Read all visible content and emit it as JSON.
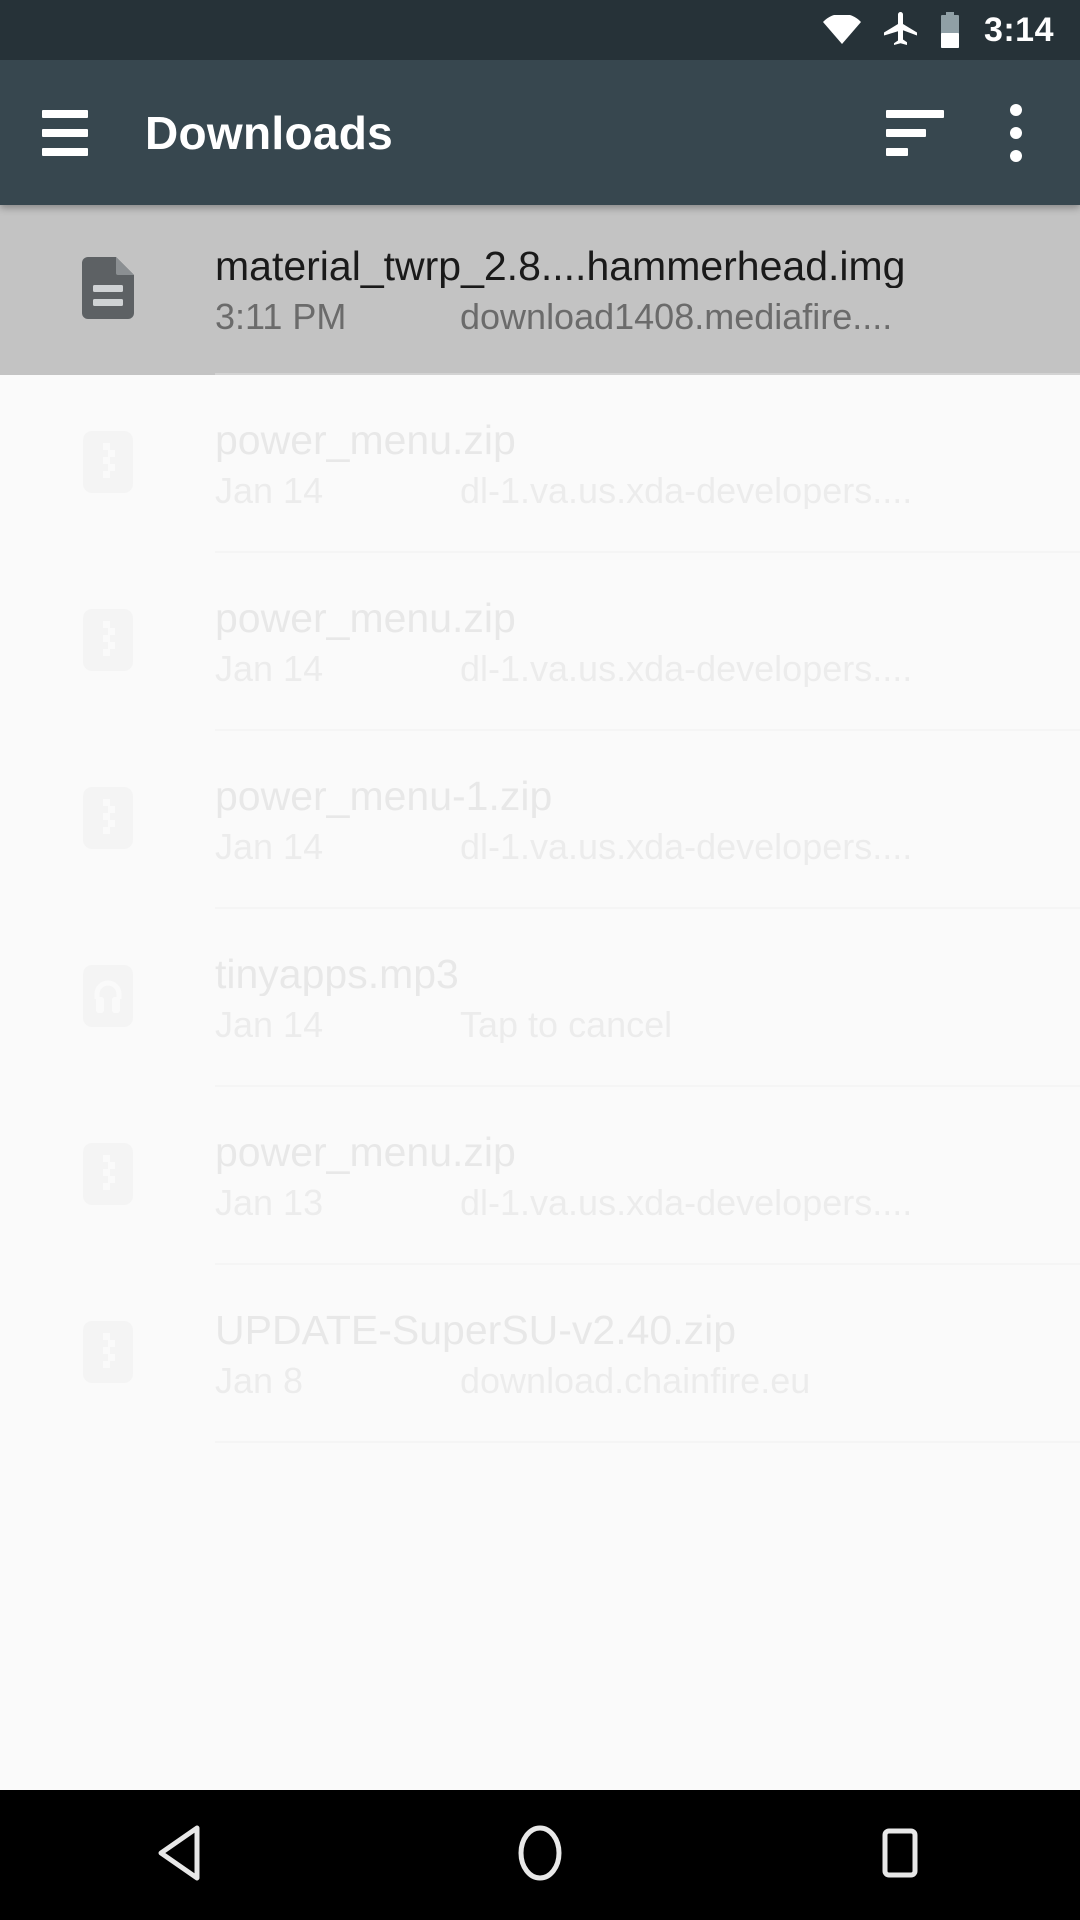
{
  "statusbar": {
    "time": "3:14",
    "icons": [
      "wifi-icon",
      "airplane-mode-icon",
      "battery-icon"
    ],
    "battery_level_pct": 42,
    "background": "#263238"
  },
  "toolbar": {
    "title": "Downloads",
    "menu_icon": "hamburger-menu-icon",
    "sort_icon": "sort-icon",
    "overflow_icon": "overflow-menu-icon",
    "background": "#37474F"
  },
  "list": {
    "items": [
      {
        "name": "material_twrp_2.8....hammerhead.img",
        "date": "3:11 PM",
        "source": "download1408.mediafire....",
        "icon": "document-file-icon",
        "selected": true
      },
      {
        "name": "power_menu.zip",
        "date": "Jan 14",
        "source": "dl-1.va.us.xda-developers....",
        "icon": "zip-file-icon",
        "selected": false
      },
      {
        "name": "power_menu.zip",
        "date": "Jan 14",
        "source": "dl-1.va.us.xda-developers....",
        "icon": "zip-file-icon",
        "selected": false
      },
      {
        "name": "power_menu-1.zip",
        "date": "Jan 14",
        "source": "dl-1.va.us.xda-developers....",
        "icon": "zip-file-icon",
        "selected": false
      },
      {
        "name": "tinyapps.mp3",
        "date": "Jan 14",
        "source": "Tap to cancel",
        "icon": "audio-file-icon",
        "selected": false
      },
      {
        "name": "power_menu.zip",
        "date": "Jan 13",
        "source": "dl-1.va.us.xda-developers....",
        "icon": "zip-file-icon",
        "selected": false
      },
      {
        "name": "UPDATE-SuperSU-v2.40.zip",
        "date": "Jan 8",
        "source": "download.chainfire.eu",
        "icon": "zip-file-icon",
        "selected": false
      }
    ],
    "selected_background": "#c3c3c3",
    "background": "#fafafa"
  },
  "navbar": {
    "back": "back-button",
    "home": "home-button",
    "recents": "recents-button",
    "background": "#000000"
  }
}
